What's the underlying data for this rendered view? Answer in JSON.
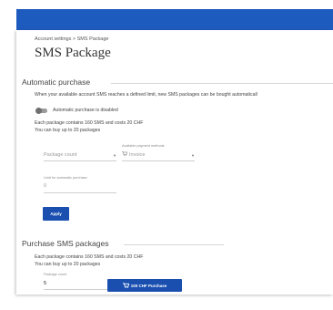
{
  "breadcrumb": "Account settings > SMS Package",
  "page_title": "SMS Package",
  "automatic": {
    "section_title": "Automatic purchase",
    "description": "When your available account SMS reaches a defined limit, new SMS packages can be bought automaticall",
    "toggle_label": "Automatic purchase is disabled",
    "toggle_on": false,
    "package_info": "Each package contains 160 SMS and costs 20 CHF",
    "limit_info": "You can buy up to 20 packages",
    "package_count_placeholder": "Package count",
    "payment_method_label": "Available payment methods",
    "payment_method_value": "Invoice",
    "limit_label": "Limit for automatic purchase",
    "limit_value": "0",
    "apply_label": "Apply"
  },
  "purchase": {
    "section_title": "Purchase SMS packages",
    "package_info": "Each package contains 160 SMS and costs 20 CHF",
    "limit_info": "You can buy up to 20 packages",
    "package_count_label": "Package count",
    "package_count_value": "5",
    "purchase_label": "100 CHF Purchase"
  },
  "colors": {
    "topbar": "#1e5bbf",
    "button": "#1a4fb0"
  }
}
